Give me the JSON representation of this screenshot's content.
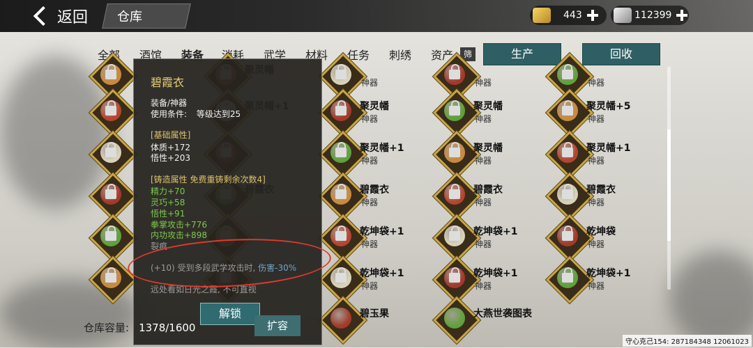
{
  "header": {
    "back_label": "返回",
    "title": "仓库",
    "gold": "443",
    "silver": "112399"
  },
  "categories": [
    "全部",
    "酒馆",
    "装备",
    "消耗",
    "武学",
    "材料",
    "任务",
    "刺绣",
    "资产"
  ],
  "active_category": "装备",
  "filter_label": "筛",
  "actions": {
    "produce": "生产",
    "recycle": "回收"
  },
  "grid": {
    "col1": [
      {
        "name": "",
        "type": ""
      },
      {
        "name": "",
        "type": ""
      },
      {
        "name": "",
        "type": ""
      },
      {
        "name": "",
        "type": ""
      },
      {
        "name": "",
        "type": ""
      },
      {
        "name": "",
        "type": ""
      }
    ],
    "col2": [
      {
        "name": "聚灵幡",
        "type": ""
      },
      {
        "name": "聚灵幡+1",
        "type": ""
      },
      {
        "name": "",
        "type": ""
      },
      {
        "name": "碧霞衣",
        "type": ""
      },
      {
        "name": "",
        "type": ""
      },
      {
        "name": "",
        "type": ""
      }
    ],
    "col3": [
      {
        "name": "",
        "type": "神器"
      },
      {
        "name": "聚灵幡",
        "type": "神器"
      },
      {
        "name": "聚灵幡+1",
        "type": "神器"
      },
      {
        "name": "碧霞衣",
        "type": "神器"
      },
      {
        "name": "乾坤袋+1",
        "type": "神器"
      },
      {
        "name": "乾坤袋+1",
        "type": "神器"
      },
      {
        "name": "碧玉果",
        "type": ""
      }
    ],
    "col4": [
      {
        "name": "",
        "type": "神器"
      },
      {
        "name": "聚灵幡",
        "type": "神器"
      },
      {
        "name": "聚灵幡",
        "type": "神器"
      },
      {
        "name": "碧霞衣",
        "type": "神器"
      },
      {
        "name": "乾坤袋+1",
        "type": "神器"
      },
      {
        "name": "乾坤袋+1",
        "type": "神器"
      },
      {
        "name": "大燕世袭图表",
        "type": ""
      }
    ],
    "col5": [
      {
        "name": "",
        "type": "神器"
      },
      {
        "name": "聚灵幡+5",
        "type": "神器"
      },
      {
        "name": "聚灵幡+1",
        "type": "神器"
      },
      {
        "name": "碧霞衣",
        "type": "神器"
      },
      {
        "name": "乾坤袋",
        "type": "神器"
      },
      {
        "name": "乾坤袋+1",
        "type": "神器"
      }
    ]
  },
  "tooltip": {
    "name": "碧霞衣",
    "category": "装备/神器",
    "requirement_label": "使用条件:",
    "requirement_value": "等级达到25",
    "base_header": "[基础属性]",
    "base_stats": [
      "体质+172",
      "悟性+203"
    ],
    "forge_header": "[铸造属性  免费重铸剩余次数4]",
    "forge_stats": [
      "精力+70",
      "灵巧+58",
      "悟性+91",
      "拳掌攻击+776",
      "内功攻击+898"
    ],
    "crack_label": "裂痕",
    "special_prefix": "(+10) 受到多段武学攻击时,",
    "special_effect": "伤害-30%",
    "description": "远处看如日光之霞, 不可直视",
    "unlock_label": "解锁"
  },
  "storage": {
    "label": "仓库容量:",
    "value": "1378/1600",
    "expand_label": "扩容"
  },
  "footer_text": "守心克己154: 287184348  12061023",
  "colors": {
    "gold_frame": "#c9a640",
    "teal_button": "#2f5f64",
    "stat_green": "#7cc94a",
    "annotation_red": "#e23a2a"
  }
}
